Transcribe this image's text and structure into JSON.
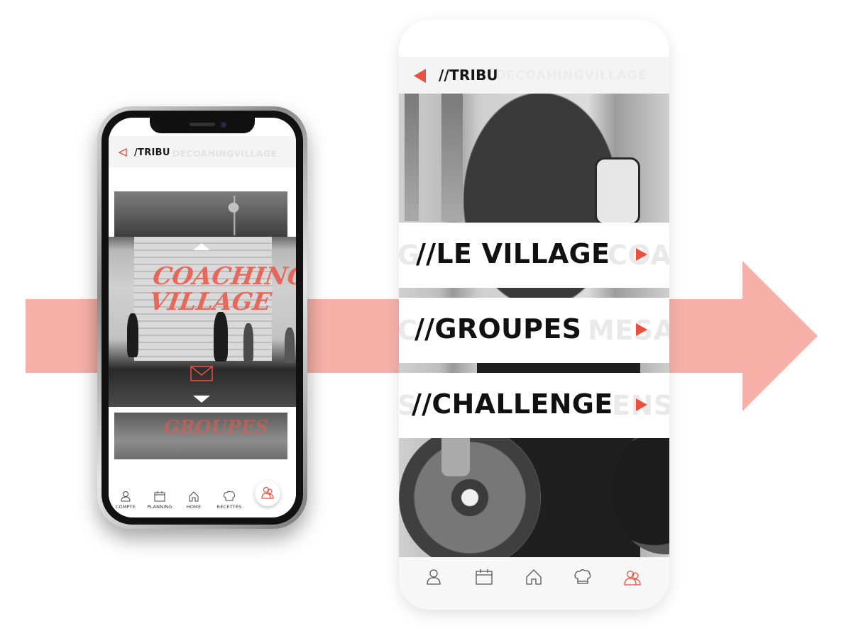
{
  "colors": {
    "accent": "#e8503f",
    "flow_arrow": "#f7b1a9",
    "header_bg": "#f4f4f4",
    "ghost_text": "#e6e6e6"
  },
  "small_phone": {
    "header": {
      "back_icon": "triangle-left-outline-icon",
      "title": "/TRIBU",
      "ghost": "DECOAHINGVILLAGE"
    },
    "carousel": {
      "main_word": "COACHING VILLAGE",
      "next_word": "GROUPES",
      "up_icon": "triangle-up-icon",
      "down_icon": "triangle-down-icon",
      "mail_icon": "envelope-icon"
    },
    "nav": [
      {
        "label": "COMPTE",
        "icon": "user-icon"
      },
      {
        "label": "PLANNING",
        "icon": "calendar-icon"
      },
      {
        "label": "HOME",
        "icon": "home-icon"
      },
      {
        "label": "RECETTES",
        "icon": "chef-hat-icon"
      }
    ],
    "fab_icon": "group-icon"
  },
  "big_phone": {
    "header": {
      "back_icon": "triangle-left-icon",
      "title": "//TRIBU",
      "ghost": "DECOAHINGVILLAGE"
    },
    "menu": [
      {
        "label": "//LE VILLAGE",
        "ghost_left": "G",
        "ghost_right": "COA"
      },
      {
        "label": "//GROUPES",
        "ghost_left": "C",
        "ghost_right": "MESAM"
      },
      {
        "label": "//CHALLENGE",
        "ghost_left": "S",
        "ghost_right": "ENS"
      }
    ],
    "nav_icons": [
      "user-icon",
      "calendar-icon",
      "home-icon",
      "chef-hat-icon",
      "group-icon"
    ],
    "active_nav": "group-icon"
  }
}
